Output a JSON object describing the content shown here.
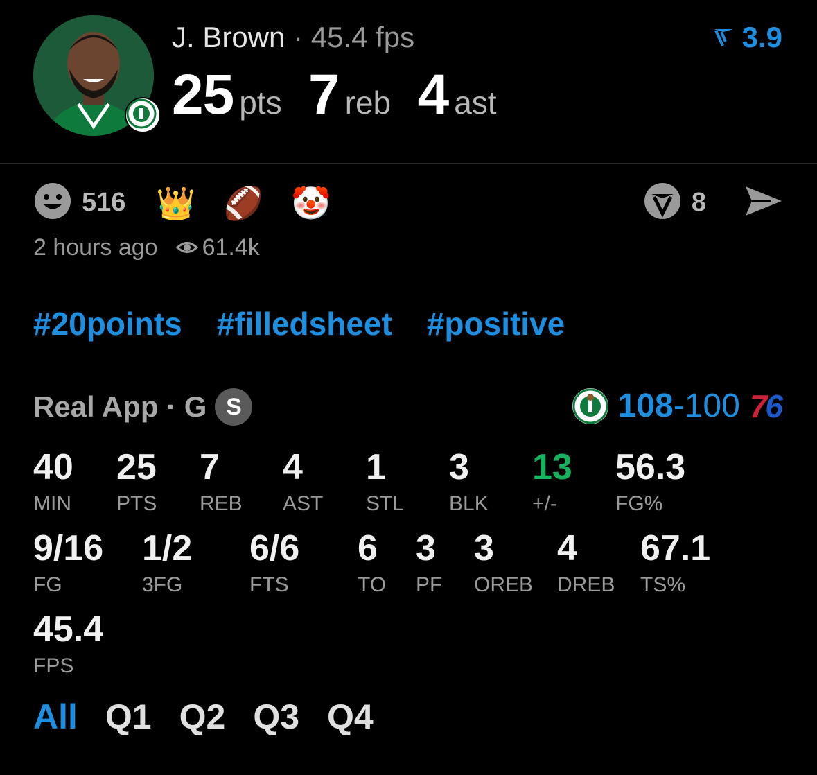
{
  "player": {
    "name": "J. Brown",
    "fps_text": "45.4 fps"
  },
  "headline": {
    "pts_value": "25",
    "pts_unit": "pts",
    "reb_value": "7",
    "reb_unit": "reb",
    "ast_value": "4",
    "ast_unit": "ast"
  },
  "rating": "3.9",
  "reactions": {
    "count": "516",
    "emojis": [
      "👑",
      "🏈",
      "🤡"
    ]
  },
  "comments": {
    "count": "8"
  },
  "meta": {
    "time_ago": "2 hours ago",
    "views": "61.4k"
  },
  "tags": [
    "#20points",
    "#filledsheet",
    "#positive"
  ],
  "game": {
    "source": "Real App · G",
    "badge": "S",
    "home_score": "108",
    "separator": "-",
    "away_score": "100",
    "away_logo_text_7": "7",
    "away_logo_text_6": "6"
  },
  "stats_row1": [
    {
      "v": "40",
      "l": "MIN"
    },
    {
      "v": "25",
      "l": "PTS"
    },
    {
      "v": "7",
      "l": "REB"
    },
    {
      "v": "4",
      "l": "AST"
    },
    {
      "v": "1",
      "l": "STL"
    },
    {
      "v": "3",
      "l": "BLK"
    },
    {
      "v": "13",
      "l": "+/-"
    },
    {
      "v": "56.3",
      "l": "FG%"
    }
  ],
  "stats_row2": [
    {
      "v": "9/16",
      "l": "FG"
    },
    {
      "v": "1/2",
      "l": "3FG"
    },
    {
      "v": "6/6",
      "l": "FTS"
    },
    {
      "v": "6",
      "l": "TO"
    },
    {
      "v": "3",
      "l": "PF"
    },
    {
      "v": "3",
      "l": "OREB"
    },
    {
      "v": "4",
      "l": "DREB"
    },
    {
      "v": "67.1",
      "l": "TS%"
    }
  ],
  "stats_row3": [
    {
      "v": "45.4",
      "l": "FPS"
    }
  ],
  "tabs": [
    "All",
    "Q1",
    "Q2",
    "Q3",
    "Q4"
  ],
  "colors": {
    "accent": "#1e8fe0",
    "positive": "#18b160",
    "background": "#000000"
  }
}
